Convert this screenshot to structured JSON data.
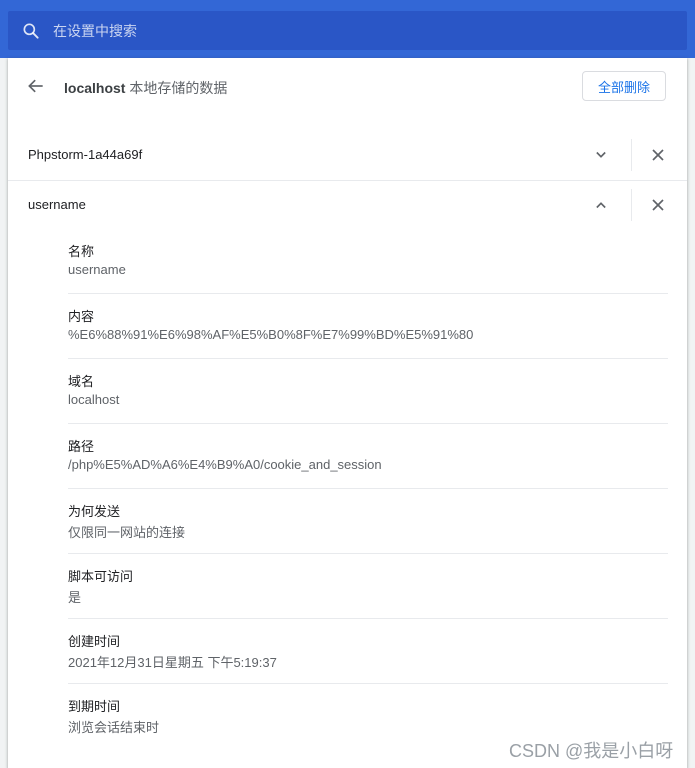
{
  "search": {
    "placeholder": "在设置中搜索"
  },
  "header": {
    "host": "localhost",
    "title_suffix": " 本地存储的数据",
    "remove_all_label": "全部删除"
  },
  "cookies": [
    {
      "name": "Phpstorm-1a44a69f",
      "expanded": false
    },
    {
      "name": "username",
      "expanded": true
    }
  ],
  "details": [
    {
      "label": "名称",
      "value": "username"
    },
    {
      "label": "内容",
      "value": "%E6%88%91%E6%98%AF%E5%B0%8F%E7%99%BD%E5%91%80"
    },
    {
      "label": "域名",
      "value": "localhost"
    },
    {
      "label": "路径",
      "value": "/php%E5%AD%A6%E4%B9%A0/cookie_and_session"
    },
    {
      "label": "为何发送",
      "value": "仅限同一网站的连接"
    },
    {
      "label": "脚本可访问",
      "value": "是"
    },
    {
      "label": "创建时间",
      "value": "2021年12月31日星期五 下午5:19:37"
    },
    {
      "label": "到期时间",
      "value": "浏览会话结束时"
    }
  ],
  "watermark": "CSDN @我是小白呀",
  "colors": {
    "topbar": "#3367d6",
    "searchbox": "#2a56c6",
    "accent": "#1a73e8"
  }
}
